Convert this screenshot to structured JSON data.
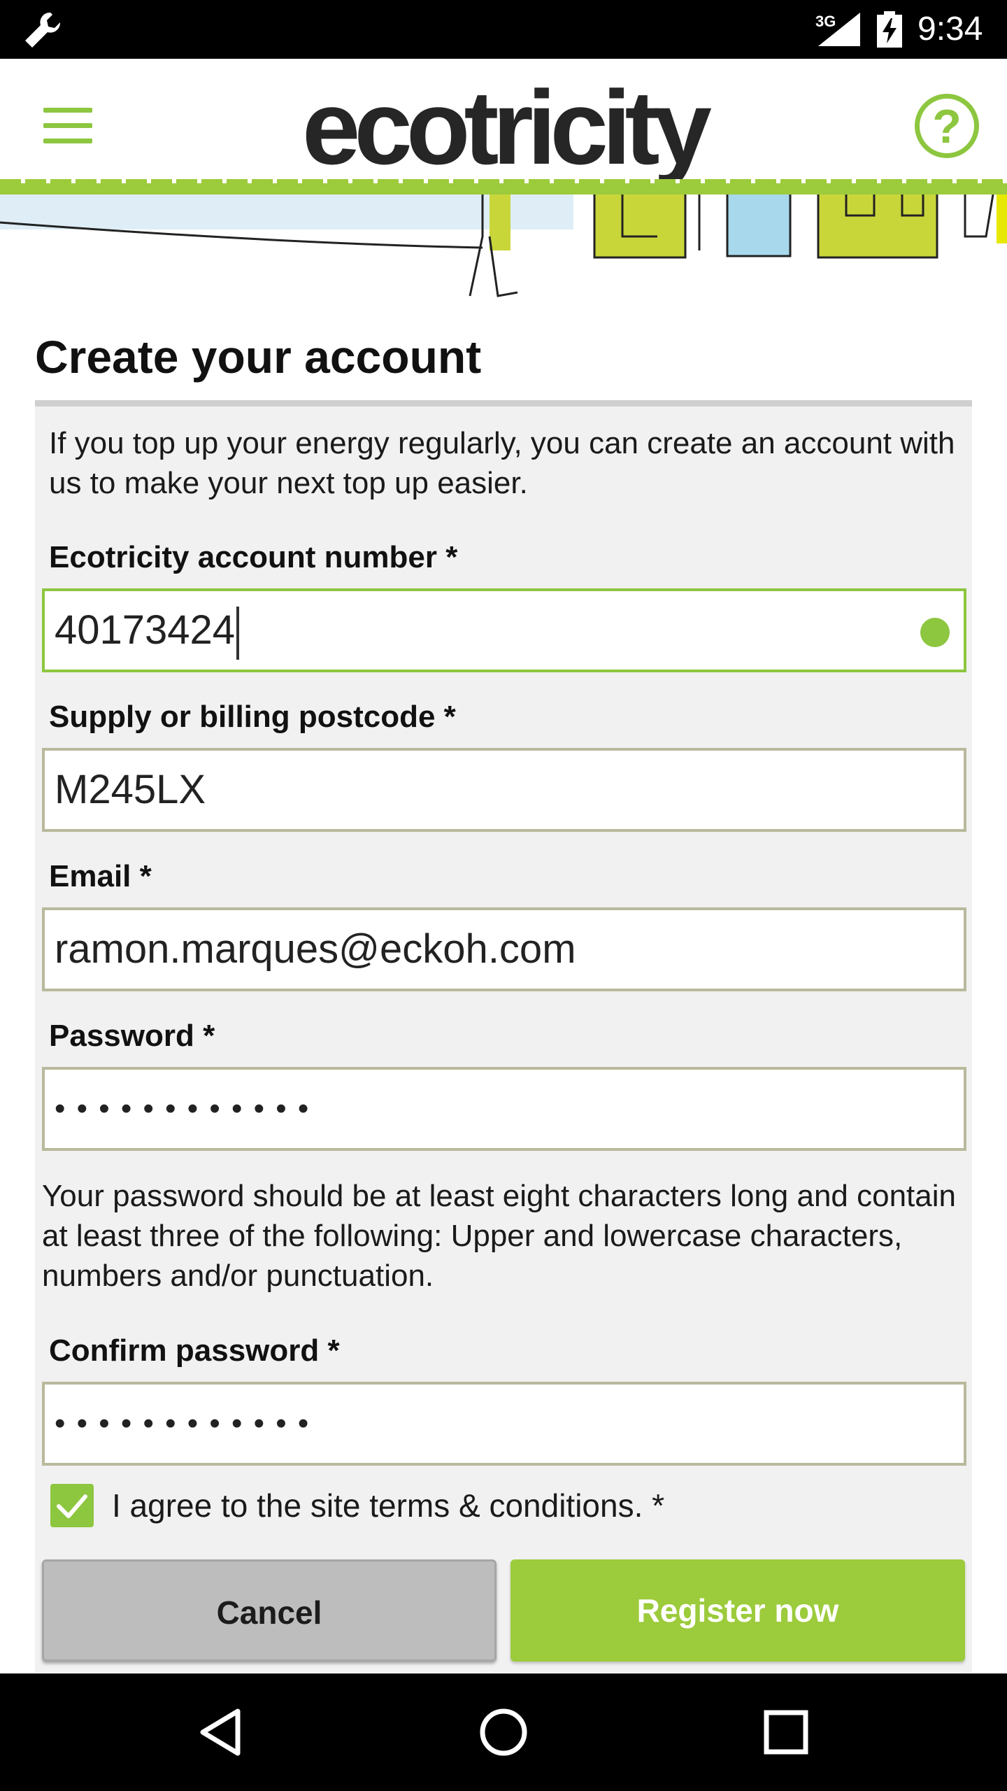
{
  "status_bar": {
    "network": "3G",
    "time": "9:34",
    "icons": [
      "wrench-icon",
      "signal-icon",
      "battery-charging-icon"
    ]
  },
  "header": {
    "logo_text": "ecotricity",
    "menu_icon": "hamburger-menu-icon",
    "help_icon": "help-icon",
    "help_symbol": "?"
  },
  "page": {
    "title": "Create your account",
    "intro": "If you top up your energy regularly, you can create an account with us to make your next top up easier."
  },
  "form": {
    "account_number": {
      "label": "Ecotricity account number *",
      "value": "40173424"
    },
    "postcode": {
      "label": "Supply or billing postcode *",
      "value": "M245LX"
    },
    "email": {
      "label": "Email *",
      "value": "ramon.marques@eckoh.com"
    },
    "password": {
      "label": "Password *",
      "value": "• • • • • • • • • • • •"
    },
    "password_help": "Your password should be at least eight characters long and contain at least three of the following: Upper and lowercase characters, numbers and/or punctuation.",
    "confirm_password": {
      "label": "Confirm password *",
      "value": "• • • • • • • • • • • •"
    },
    "terms": {
      "label": "I agree to the site terms & conditions. *",
      "checked": true
    },
    "cancel_label": "Cancel",
    "register_label": "Register now"
  },
  "colors": {
    "accent_green": "#9ccb3b",
    "panel_bg": "#f1f1f1",
    "cancel_bg": "#bdbdbd"
  },
  "nav_bar": {
    "icons": [
      "back-icon",
      "home-icon",
      "recents-icon"
    ]
  }
}
